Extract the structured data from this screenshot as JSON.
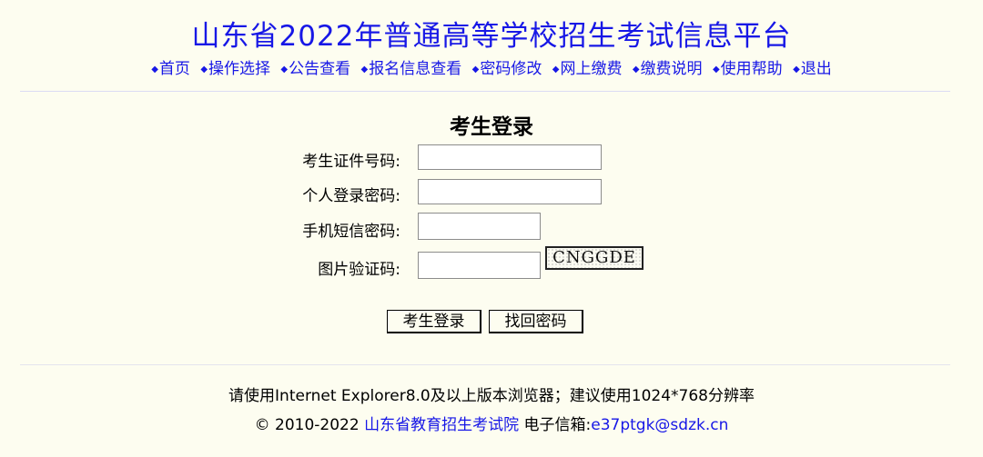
{
  "header": {
    "title": "山东省2022年普通高等学校招生考试信息平台",
    "nav": [
      {
        "label": "首页",
        "icon": "diamond-bullet"
      },
      {
        "label": "操作选择",
        "icon": "diamond-bullet"
      },
      {
        "label": "公告查看",
        "icon": "diamond-bullet"
      },
      {
        "label": "报名信息查看",
        "icon": "diamond-bullet"
      },
      {
        "label": "密码修改",
        "icon": "diamond-bullet"
      },
      {
        "label": "网上缴费",
        "icon": "diamond-bullet"
      },
      {
        "label": "缴费说明",
        "icon": "diamond-bullet"
      },
      {
        "label": "使用帮助",
        "icon": "diamond-bullet"
      },
      {
        "label": "退出",
        "icon": "diamond-bullet"
      }
    ],
    "bullet": "◆"
  },
  "login": {
    "title": "考生登录",
    "fields": [
      {
        "label": "考生证件号码:",
        "value": ""
      },
      {
        "label": "个人登录密码:",
        "value": ""
      },
      {
        "label": "手机短信密码:",
        "value": ""
      },
      {
        "label": "图片验证码:",
        "value": ""
      }
    ],
    "captcha_text": "CNGGDE",
    "login_button": "考生登录",
    "recover_button": "找回密码"
  },
  "footer": {
    "browser_note": "请使用Internet Explorer8.0及以上版本浏览器；建议使用1024*768分辨率",
    "copyright": "© 2010-2022",
    "org": "山东省教育招生考试院",
    "email_label": "电子信箱:",
    "email": "e37ptgk@sdzk.cn"
  },
  "colors": {
    "accent": "#1717e6",
    "background": "#fdfdf0"
  }
}
